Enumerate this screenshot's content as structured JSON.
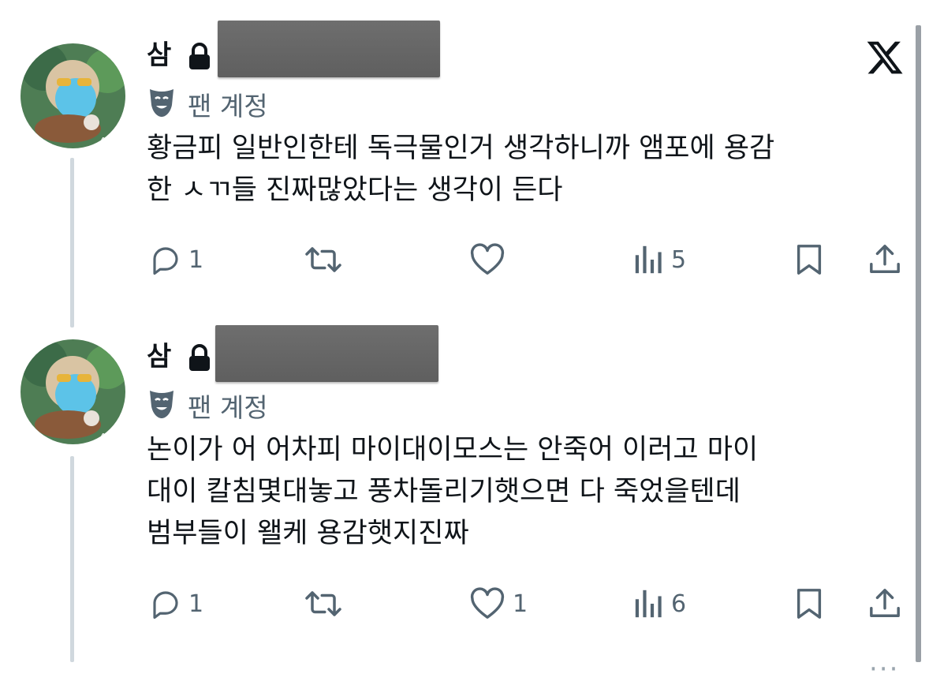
{
  "brand": {
    "icon": "x-logo-icon"
  },
  "tweets": [
    {
      "author_name": "삼",
      "badge_label": "팬 계정",
      "text_lines": [
        "황금피 일반인한테 독극물인거 생각하니까 앰포에 용감",
        "한 ㅅㄲ들 진짜많았다는 생각이 든다"
      ],
      "replies": "1",
      "reposts": "",
      "likes": "",
      "views": "5"
    },
    {
      "author_name": "삼",
      "badge_label": "팬 계정",
      "text_lines": [
        "논이가 어 어차피 마이대이모스는 안죽어 이러고 마이",
        "대이 칼침몇대놓고 풍차돌리기햇으면 다 죽었을텐데",
        "범부들이 왤케 용감햇지진짜"
      ],
      "replies": "1",
      "reposts": "",
      "likes": "1",
      "views": "6"
    }
  ],
  "more_menu": "···",
  "colors": {
    "text": "#0f1419",
    "secondary": "#536471",
    "thread": "#d0d8de"
  }
}
